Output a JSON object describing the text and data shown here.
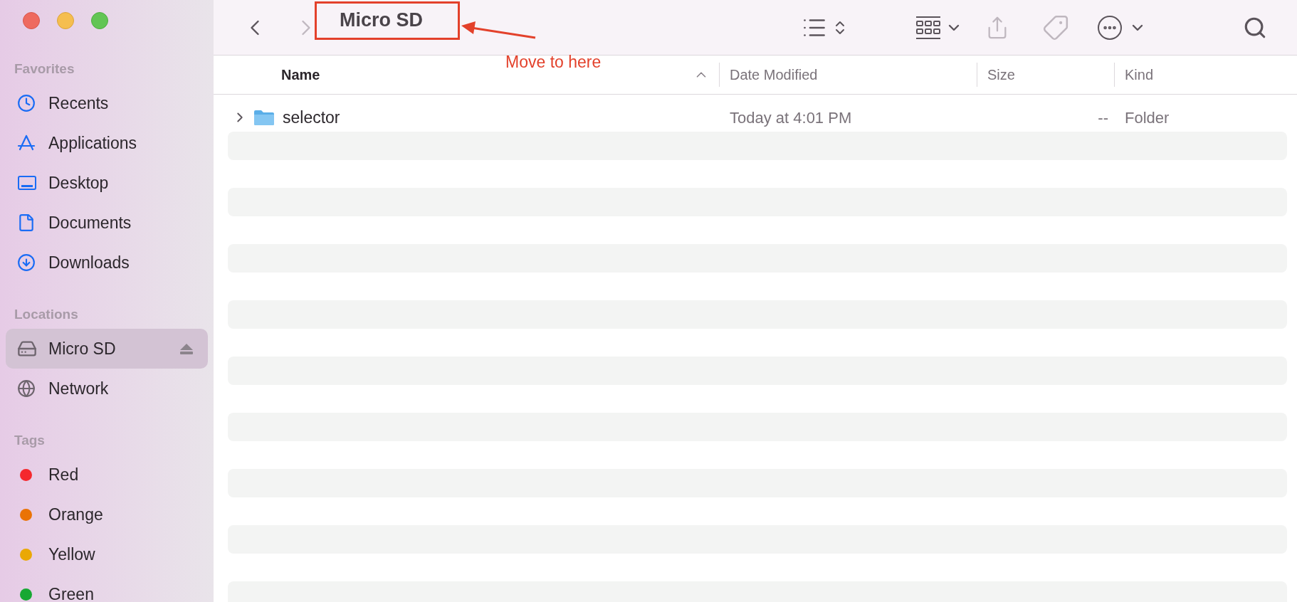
{
  "sidebar": {
    "sections": [
      {
        "heading": "Favorites",
        "items": [
          {
            "label": "Recents",
            "kind": "clock",
            "selected": false
          },
          {
            "label": "Applications",
            "kind": "apps",
            "selected": false
          },
          {
            "label": "Desktop",
            "kind": "desktop",
            "selected": false
          },
          {
            "label": "Documents",
            "kind": "document",
            "selected": false
          },
          {
            "label": "Downloads",
            "kind": "download",
            "selected": false
          }
        ]
      },
      {
        "heading": "Locations",
        "items": [
          {
            "label": "Micro SD",
            "kind": "drive",
            "selected": true
          },
          {
            "label": "Network",
            "kind": "network",
            "selected": false
          }
        ]
      },
      {
        "heading": "Tags",
        "items": [
          {
            "label": "Red",
            "kind": "tag",
            "color": "#f5282d",
            "selected": false
          },
          {
            "label": "Orange",
            "kind": "tag",
            "color": "#ea7305",
            "selected": false
          },
          {
            "label": "Yellow",
            "kind": "tag",
            "color": "#eaa805",
            "selected": false
          },
          {
            "label": "Green",
            "kind": "tag",
            "color": "#17a833",
            "selected": false
          }
        ]
      }
    ]
  },
  "toolbar": {
    "back_disabled": false,
    "forward_disabled": true,
    "title": "Micro SD",
    "share_disabled": true,
    "tag_disabled": true
  },
  "annotation": {
    "text": "Move to here"
  },
  "table": {
    "columns": [
      {
        "label": "Name",
        "sorted": true
      },
      {
        "label": "Date Modified",
        "sorted": false
      },
      {
        "label": "Size",
        "sorted": false
      },
      {
        "label": "Kind",
        "sorted": false
      }
    ],
    "rows": [
      {
        "name": "selector",
        "date_modified": "Today at 4:01 PM",
        "size": "--",
        "file_kind": "Folder",
        "expanded": false
      }
    ]
  }
}
